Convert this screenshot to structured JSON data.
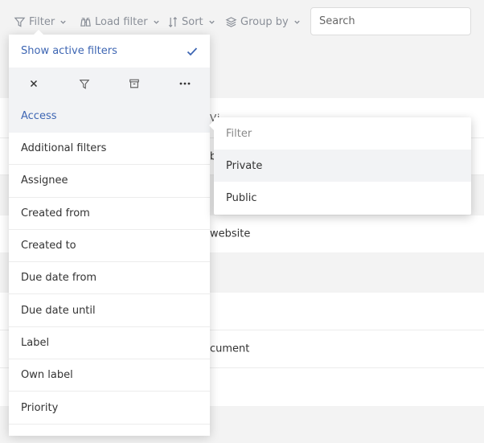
{
  "toolbar": {
    "filter_label": "Filter",
    "load_filter_label": "Load filter",
    "sort_label": "Sort",
    "group_by_label": "Group by",
    "search_placeholder": "Search"
  },
  "filter_menu": {
    "show_active_label": "Show active filters",
    "show_active_checked": true,
    "actions": [
      {
        "icon": "close-icon",
        "label": "Clear filters"
      },
      {
        "icon": "filter-icon",
        "label": "Filter"
      },
      {
        "icon": "archive-icon",
        "label": "Archive"
      },
      {
        "icon": "more-icon",
        "label": "More"
      }
    ],
    "items": [
      {
        "label": "Access",
        "active": true
      },
      {
        "label": "Additional filters"
      },
      {
        "label": "Assignee"
      },
      {
        "label": "Created from"
      },
      {
        "label": "Created to"
      },
      {
        "label": "Due date from"
      },
      {
        "label": "Due date until"
      },
      {
        "label": "Label"
      },
      {
        "label": "Own label"
      },
      {
        "label": "Priority"
      }
    ]
  },
  "access_submenu": {
    "filter_placeholder": "Filter",
    "options": [
      {
        "label": "Private",
        "hovered": true
      },
      {
        "label": "Public"
      }
    ]
  },
  "background_rows": [
    {
      "text": "Vi... ... ... ..."
    },
    {
      "text": "b"
    },
    {
      "text": ""
    },
    {
      "text": "website"
    },
    {
      "text": ""
    },
    {
      "text": "cument"
    },
    {
      "text": ""
    }
  ],
  "colors": {
    "accent": "#3e66b3",
    "page_bg": "#f3f3f3",
    "menu_highlight": "#f2f3f5"
  }
}
